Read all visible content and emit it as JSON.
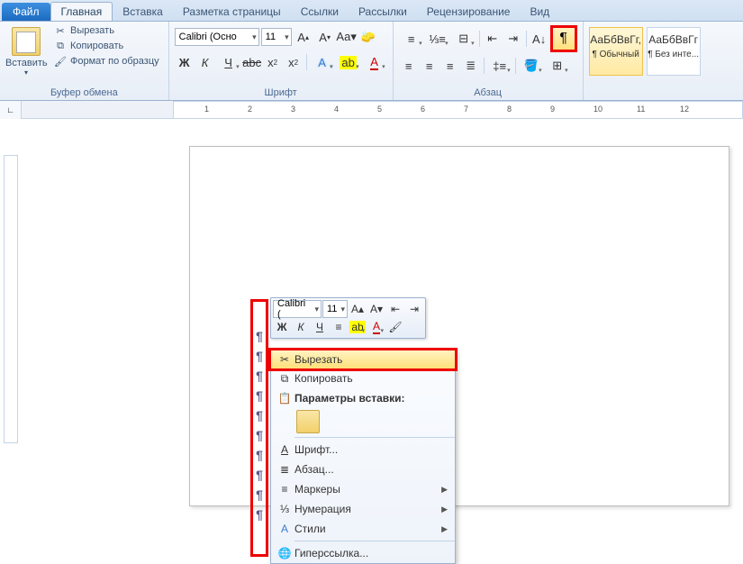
{
  "tabs": {
    "file": "Файл",
    "home": "Главная",
    "insert": "Вставка",
    "layout": "Разметка страницы",
    "refs": "Ссылки",
    "mail": "Рассылки",
    "review": "Рецензирование",
    "view": "Вид"
  },
  "clipboard": {
    "paste": "Вставить",
    "cut": "Вырезать",
    "copy": "Копировать",
    "format_painter": "Формат по образцу",
    "title": "Буфер обмена"
  },
  "font": {
    "name": "Calibri (Осно",
    "size": "11",
    "title": "Шрифт"
  },
  "para": {
    "title": "Абзац"
  },
  "styles": {
    "normal_ex": "АаБбВвГг,",
    "normal_label": "¶ Обычный",
    "nospace_ex": "АаБбВвГг",
    "nospace_label": "¶ Без инте..."
  },
  "ruler": {
    "n1": "1",
    "n2": "2",
    "n3": "3",
    "n4": "4",
    "n5": "5",
    "n6": "6",
    "n7": "7",
    "n8": "8",
    "n9": "9",
    "n10": "10",
    "n11": "11",
    "n12": "12"
  },
  "minitb": {
    "font": "Calibri (",
    "size": "11"
  },
  "ctx": {
    "cut": "Вырезать",
    "copy": "Копировать",
    "paste_opts": "Параметры вставки:",
    "font": "Шрифт...",
    "para": "Абзац...",
    "bullets": "Маркеры",
    "numbering": "Нумерация",
    "styles": "Стили",
    "hyperlink": "Гиперссылка..."
  },
  "pilcrow": "¶"
}
